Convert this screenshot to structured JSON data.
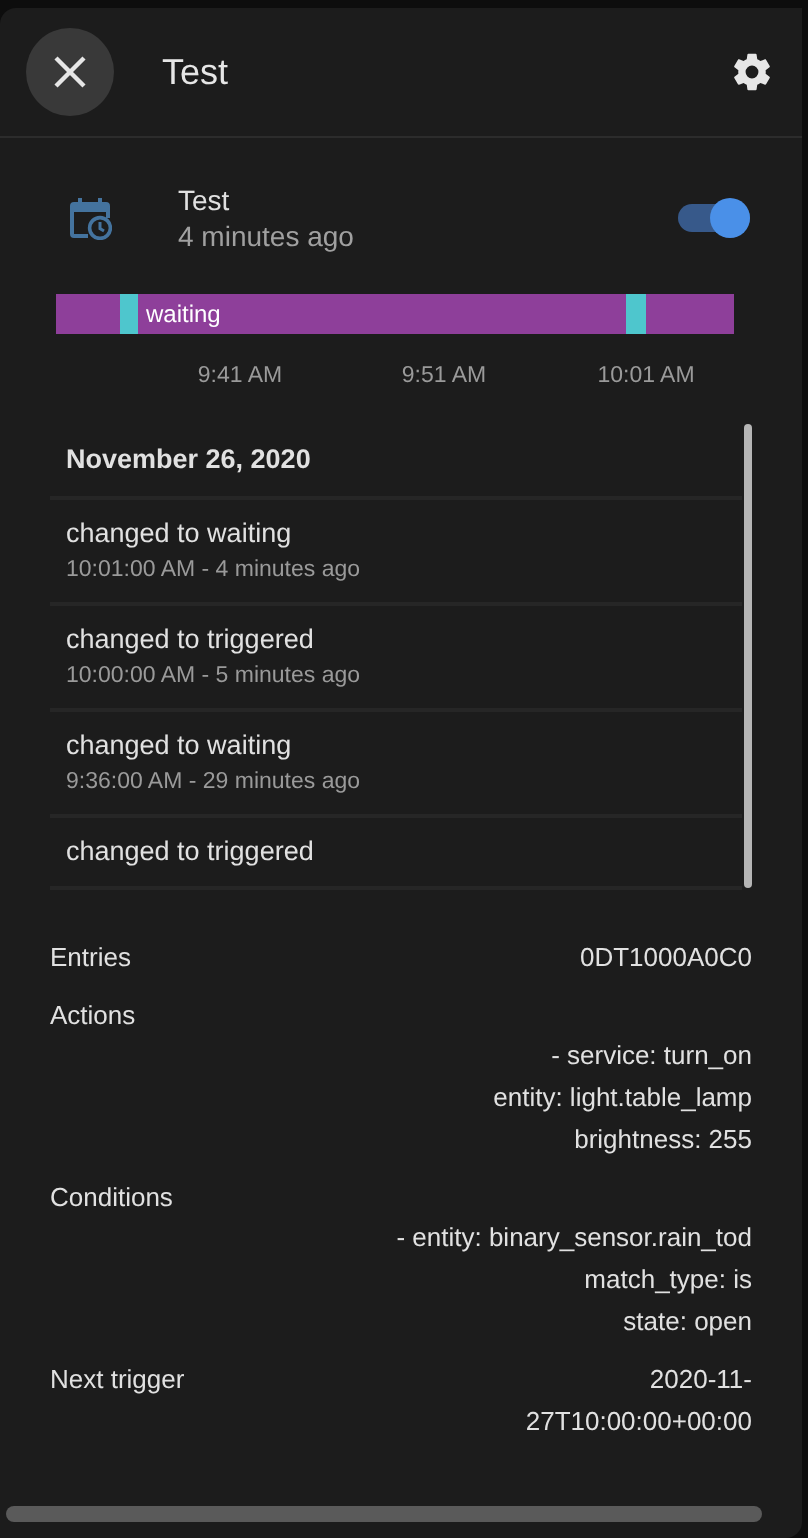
{
  "header": {
    "title": "Test"
  },
  "entity": {
    "name": "Test",
    "last_changed": "4 minutes ago",
    "on": true
  },
  "history": {
    "segment_label": "waiting",
    "ticks": [
      "9:41 AM",
      "9:51 AM",
      "10:01 AM"
    ]
  },
  "logbook": {
    "date": "November 26, 2020",
    "entries": [
      {
        "message": "changed to waiting",
        "time": "10:01:00 AM - 4 minutes ago"
      },
      {
        "message": "changed to triggered",
        "time": "10:00:00 AM - 5 minutes ago"
      },
      {
        "message": "changed to waiting",
        "time": "9:36:00 AM - 29 minutes ago"
      },
      {
        "message": "changed to triggered"
      }
    ]
  },
  "attributes": [
    {
      "label": "Entries",
      "value": [
        "0DT1000A0C0"
      ]
    },
    {
      "label": "Actions",
      "value": [
        "- service: turn_on",
        "entity: light.table_lamp",
        "brightness: 255"
      ]
    },
    {
      "label": "Conditions",
      "value": [
        "- entity: binary_sensor.rain_tod",
        "match_type: is",
        "state: open"
      ]
    },
    {
      "label": "Next trigger",
      "value": [
        "2020-11-27T10:00:00+00:00"
      ]
    }
  ]
}
